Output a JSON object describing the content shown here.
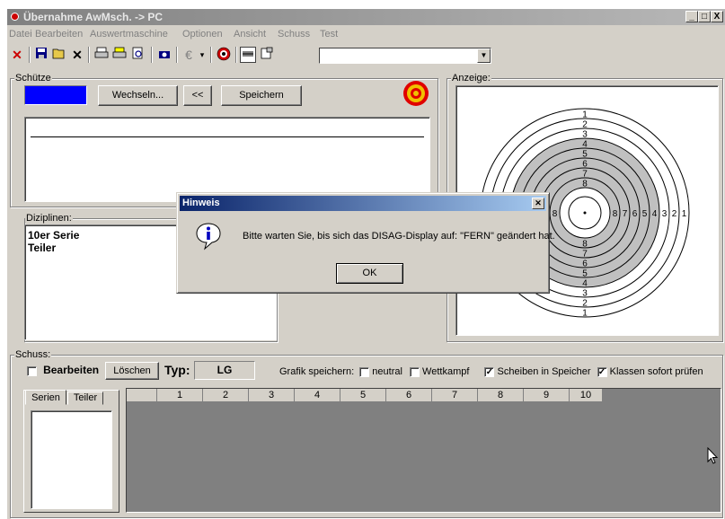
{
  "window": {
    "title": "Übernahme AwMsch. -> PC",
    "minimize": "_",
    "restore": "□",
    "close": "X"
  },
  "menu": [
    "Datei",
    "Bearbeiten",
    "Auswertmaschine",
    "Optionen",
    "Ansicht",
    "Schuss",
    "Test"
  ],
  "toolbar": {
    "euro": "€",
    "combo_value": ""
  },
  "schuetze": {
    "label": "Schütze",
    "wechseln": "Wechseln...",
    "back": "<<",
    "speichern": "Speichern",
    "color": "#0000ff"
  },
  "disziplinen": {
    "label": "Diziplinen:",
    "items": [
      "10er Serie",
      "Teiler"
    ]
  },
  "anzeige": {
    "label": "Anzeige:",
    "rings": [
      "1",
      "2",
      "3",
      "4",
      "5",
      "6",
      "7",
      "8"
    ]
  },
  "schuss": {
    "label": "Schuss:",
    "bearbeiten": "Bearbeiten",
    "loeschen": "Löschen",
    "typ_label": "Typ:",
    "typ_value": "LG",
    "grafik_label": "Grafik speichern:",
    "neutral": "neutral",
    "wettkampf": "Wettkampf",
    "scheiben": "Scheiben in Speicher",
    "klassen": "Klassen sofort prüfen",
    "tabs": [
      "Serien",
      "Teiler"
    ],
    "columns": [
      "1",
      "2",
      "3",
      "4",
      "5",
      "6",
      "7",
      "8",
      "9",
      "10"
    ]
  },
  "dialog": {
    "title": "Hinweis",
    "message": "Bitte warten Sie, bis sich das DISAG-Display auf: \"FERN\" geändert hat.",
    "ok": "OK",
    "close": "✕"
  }
}
